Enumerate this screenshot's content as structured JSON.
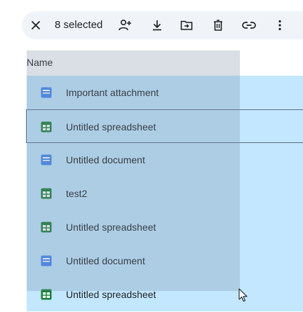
{
  "toolbar": {
    "selection_count": "8 selected",
    "buttons": [
      {
        "name": "clear-selection-button",
        "icon": "close-icon"
      },
      {
        "name": "share-button",
        "icon": "person-add-icon"
      },
      {
        "name": "download-button",
        "icon": "download-icon"
      },
      {
        "name": "move-button",
        "icon": "folder-move-icon"
      },
      {
        "name": "trash-button",
        "icon": "trash-icon"
      },
      {
        "name": "copy-link-button",
        "icon": "link-icon"
      },
      {
        "name": "more-actions-button",
        "icon": "more-vert-icon"
      }
    ]
  },
  "header": {
    "name_label": "Name"
  },
  "files": [
    {
      "name": "Important attachment",
      "type": "document"
    },
    {
      "name": "Untitled spreadsheet",
      "type": "spreadsheet"
    },
    {
      "name": "Untitled document",
      "type": "document"
    },
    {
      "name": "test2",
      "type": "spreadsheet"
    },
    {
      "name": "Untitled spreadsheet",
      "type": "spreadsheet"
    },
    {
      "name": "Untitled document",
      "type": "document"
    },
    {
      "name": "Untitled spreadsheet",
      "type": "spreadsheet"
    }
  ],
  "colors": {
    "selected_row": "#c2e7ff",
    "doc_icon": "#4285f4",
    "sheet_icon": "#188038",
    "toolbar_bg": "#f0f4f9"
  }
}
